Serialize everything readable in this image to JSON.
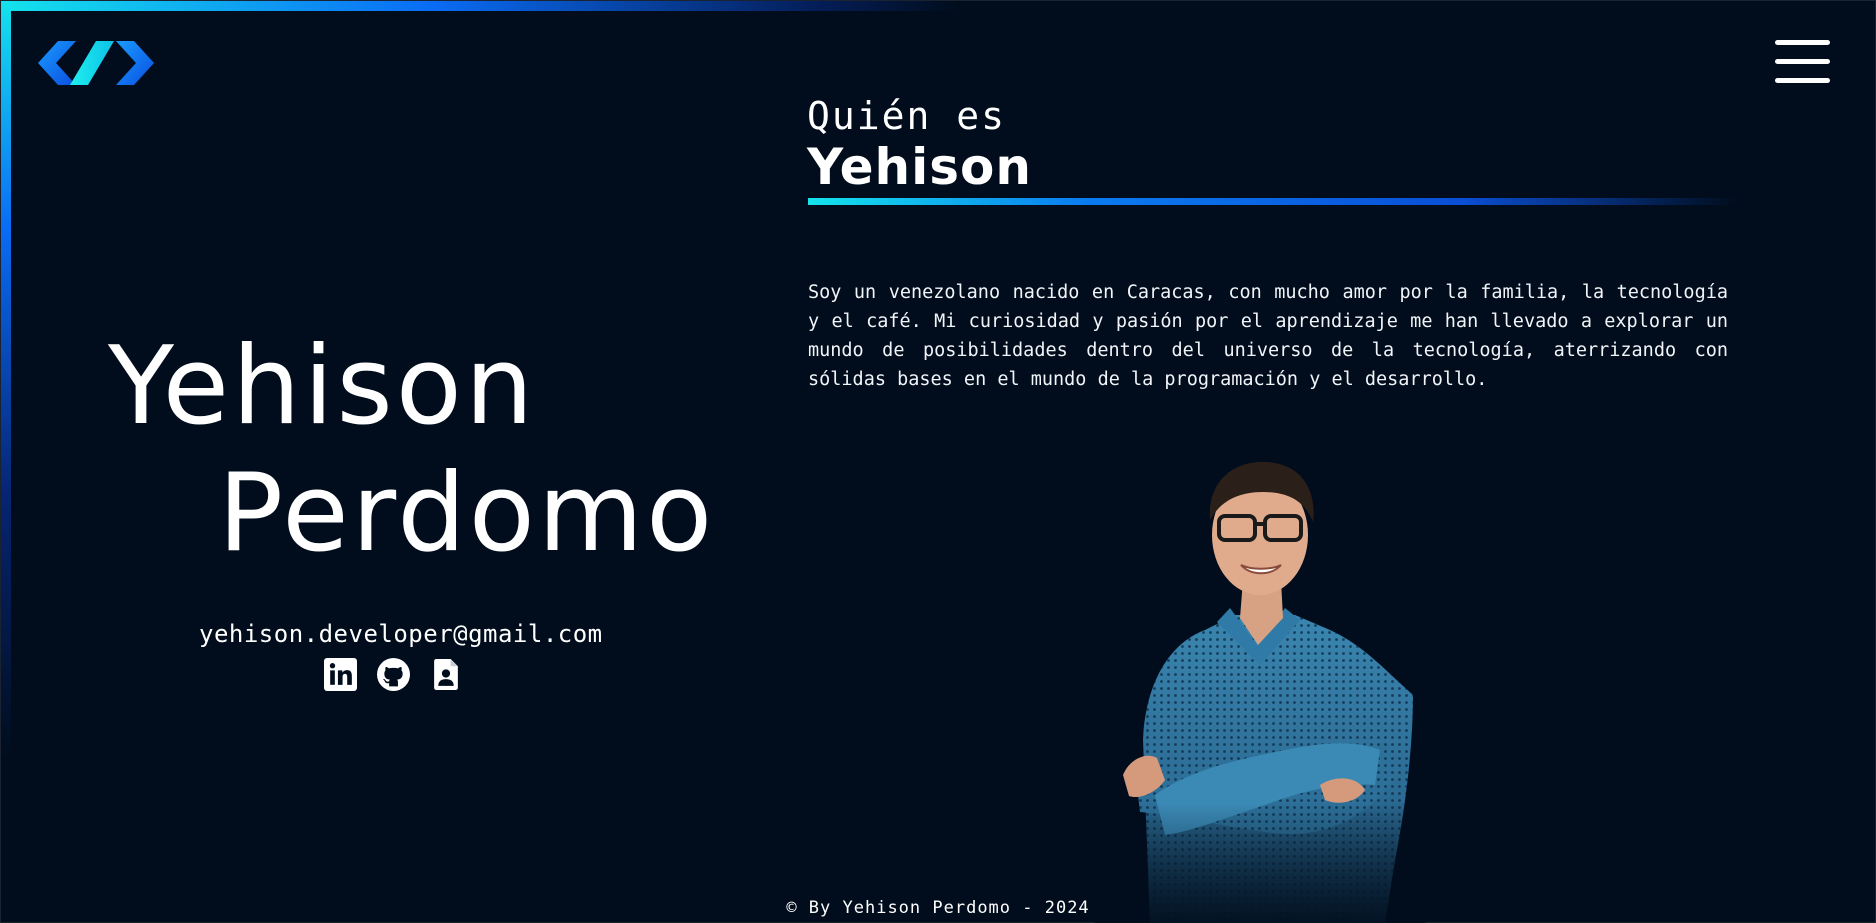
{
  "header": {
    "logo_icon": "chevrons-code-logo",
    "menu_icon": "hamburger-menu-icon"
  },
  "hero": {
    "first_name": "Yehison",
    "last_name": "Perdomo",
    "email": "yehison.developer@gmail.com",
    "social": [
      {
        "icon": "linkedin-icon"
      },
      {
        "icon": "github-icon"
      },
      {
        "icon": "resume-icon"
      }
    ]
  },
  "about": {
    "pre_title": "Quién es",
    "title": "Yehison",
    "paragraph": "Soy un venezolano nacido en Caracas, con mucho amor por la familia, la tecnología y el café. Mi curiosidad y pasión por el aprendizaje me han llevado a explorar un mundo de posibilidades dentro del universo de la tecnología, aterrizando con sólidas bases en el mundo de la programación y el desarrollo."
  },
  "footer": {
    "copyright": "© By Yehison Perdomo - 2024"
  },
  "colors": {
    "background": "#010d1c",
    "accent_cyan": "#14e3ec",
    "accent_blue": "#0a6cf5",
    "text": "#ffffff"
  }
}
